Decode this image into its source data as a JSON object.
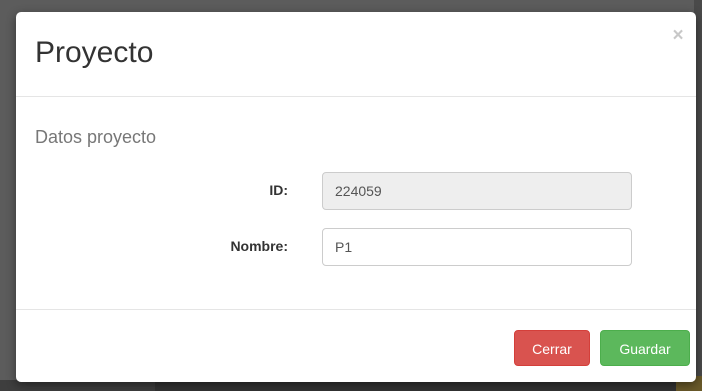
{
  "modal": {
    "title": "Proyecto",
    "close_symbol": "×"
  },
  "body": {
    "section_title": "Datos proyecto",
    "fields": {
      "id": {
        "label": "ID:",
        "value": "224059",
        "readonly": true
      },
      "nombre": {
        "label": "Nombre:",
        "value": "P1"
      }
    }
  },
  "footer": {
    "cerrar_label": "Cerrar",
    "guardar_label": "Guardar"
  },
  "colors": {
    "danger": "#d9534f",
    "success": "#5cb85c",
    "readonly_bg": "#eeeeee",
    "backdrop": "#5c5c5c"
  },
  "icons": {
    "close": "close-icon"
  }
}
